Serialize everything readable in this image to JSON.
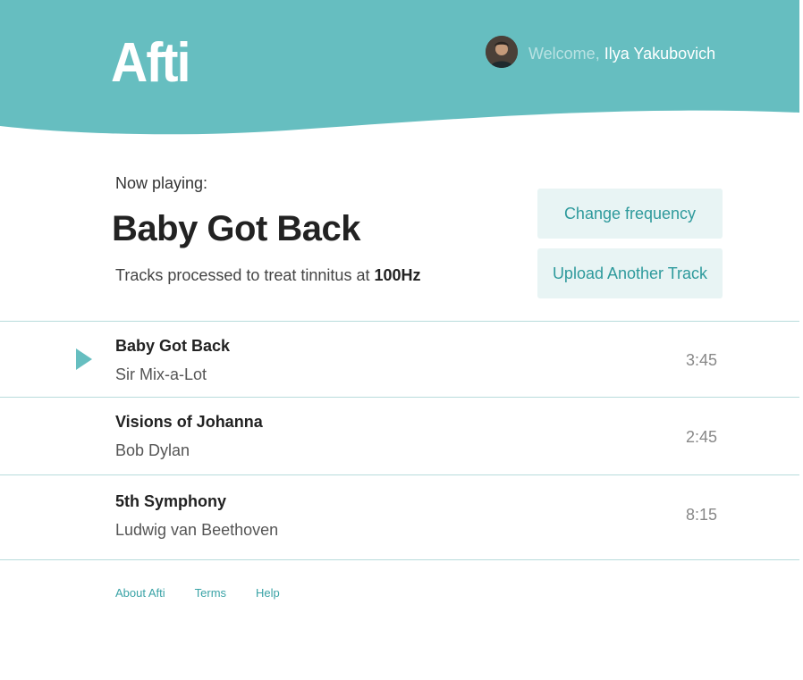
{
  "app": {
    "logo": "Afti",
    "brand_color": "#66bec0",
    "accent_text_color": "#2e9a9c"
  },
  "header": {
    "welcome_prefix": "Welcome,",
    "user_name": "Ilya Yakubovich",
    "avatar_icon": "user-avatar-photo"
  },
  "now_playing": {
    "label": "Now playing:",
    "title": "Baby Got Back",
    "subtitle_prefix": "Tracks processed to treat tinnitus at",
    "frequency": "100Hz"
  },
  "actions": {
    "change_frequency": "Change frequency",
    "upload_track": "Upload Another Track"
  },
  "tracks": [
    {
      "title": "Baby Got Back",
      "artist": "Sir Mix-a-Lot",
      "duration": "3:45",
      "playing": true,
      "icon": "play-icon"
    },
    {
      "title": "Visions of Johanna",
      "artist": "Bob Dylan",
      "duration": "2:45",
      "playing": false
    },
    {
      "title": "5th Symphony",
      "artist": "Ludwig van Beethoven",
      "duration": "8:15",
      "playing": false
    }
  ],
  "footer": {
    "links": [
      "About Afti",
      "Terms",
      "Help"
    ]
  }
}
